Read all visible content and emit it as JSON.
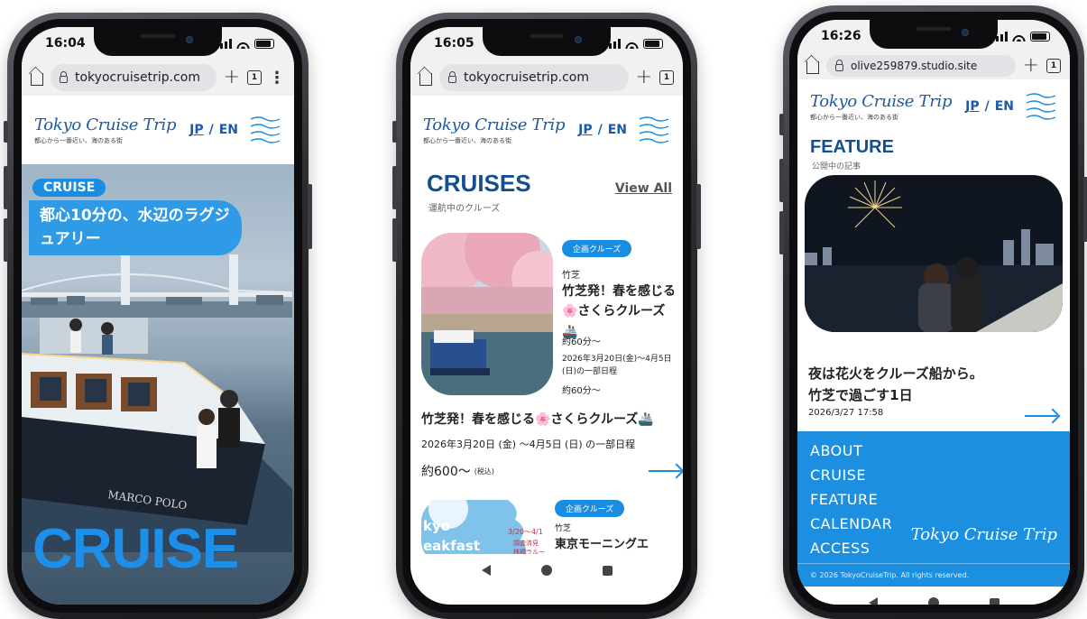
{
  "phones": [
    {
      "status": {
        "time": "16:04"
      },
      "browser": {
        "url": "tokyocruisetrip.com",
        "tab_count": "1"
      },
      "header": {
        "logo": "Tokyo Cruise Trip",
        "tagline": "都心から一番近い、海のある街",
        "lang_jp": "JP",
        "lang_sep": "/",
        "lang_en": "EN"
      },
      "hero": {
        "badge": "CRUISE",
        "catch": "都心10分の、水辺のラグジュアリー",
        "big_word": "CRUISE",
        "boat_name": "MARCO POLO"
      }
    },
    {
      "status": {
        "time": "16:05"
      },
      "browser": {
        "url": "tokyocruisetrip.com",
        "tab_count": "1"
      },
      "header": {
        "logo": "Tokyo Cruise Trip",
        "tagline": "都心から一番近い、海のある街",
        "lang_jp": "JP",
        "lang_sep": "/",
        "lang_en": "EN"
      },
      "section": {
        "title": "CRUISES",
        "subtitle": "運航中のクルーズ",
        "view_all": "View All"
      },
      "card1": {
        "tag": "企画クルーズ",
        "area": "竹芝",
        "title": "竹芝発！春を感じる🌸さくらクルーズ🚢",
        "duration": "約60分〜",
        "dates": "2026年3月20日(金)〜4月5日(日)の一部日程",
        "duration2": "約60分〜"
      },
      "featured": {
        "title": "竹芝発！春を感じる🌸さくらクルーズ🚢",
        "dates": "2026年3月20日 (金) 〜4月5日 (日) の一部日程",
        "price": "約600〜",
        "tax": "(税込)"
      },
      "card2": {
        "tag": "企画クルーズ",
        "area": "竹芝",
        "title": "東京モーニングエ",
        "img_text1": "kyo",
        "img_text2": "eakfast",
        "img_dates": "3/20〜4/1",
        "img_line2": "調査済見",
        "img_line3": "桟橋ラルー"
      }
    },
    {
      "status": {
        "time": "16:26"
      },
      "browser": {
        "url": "olive259879.studio.site",
        "tab_count": "1"
      },
      "header": {
        "logo": "Tokyo Cruise Trip",
        "tagline": "都心から一番近い、海のある街",
        "lang_jp": "JP",
        "lang_sep": "/",
        "lang_en": "EN"
      },
      "section": {
        "title": "FEATURE",
        "subtitle": "公開中の記事"
      },
      "article": {
        "title_line1": "夜は花火をクルーズ船から。",
        "title_line2": "竹芝で過ごす1日",
        "datetime": "2026/3/27 17:58"
      },
      "menu": [
        "ABOUT",
        "CRUISE",
        "FEATURE",
        "CALENDAR",
        "ACCESS"
      ],
      "footer_logo": "Tokyo Cruise Trip",
      "copyright": "© 2026 TokyoCruiseTrip. All rights reserved."
    }
  ],
  "colors": {
    "brand_blue": "#1a8de0",
    "navy": "#134f8e"
  }
}
